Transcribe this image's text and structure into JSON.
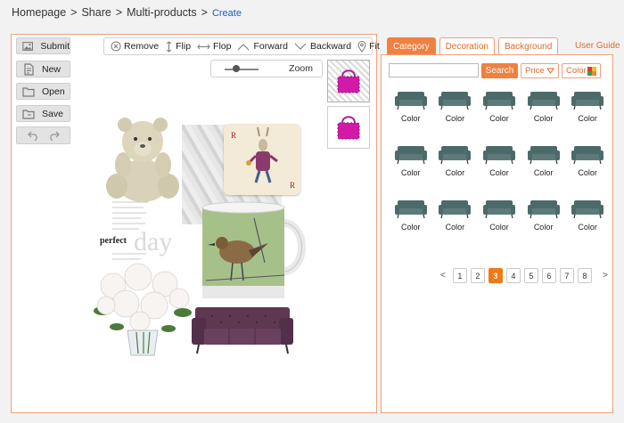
{
  "breadcrumb": {
    "items": [
      "Homepage",
      "Share",
      "Multi-products"
    ],
    "separator": ">",
    "current": "Create"
  },
  "editor": {
    "side_buttons": [
      {
        "label": "Submit",
        "icon": "image-icon"
      },
      {
        "label": "New",
        "icon": "new-file-icon"
      },
      {
        "label": "Open",
        "icon": "folder-icon"
      },
      {
        "label": "Save",
        "icon": "save-folder-icon"
      }
    ],
    "undo_icon": "undo-icon",
    "redo_icon": "redo-icon",
    "toolbar": [
      {
        "label": "Remove",
        "icon": "remove-icon"
      },
      {
        "label": "Flip",
        "icon": "flip-vertical-icon"
      },
      {
        "label": "Flop",
        "icon": "flop-horizontal-icon"
      },
      {
        "label": "Forward",
        "icon": "forward-icon"
      },
      {
        "label": "Backward",
        "icon": "backward-icon"
      },
      {
        "label": "Fit",
        "icon": "fit-icon"
      }
    ],
    "zoom_label": "Zoom",
    "zoom_level": 0.2,
    "canvas_text": {
      "perfect": "perfect",
      "day": "day"
    }
  },
  "right_panel": {
    "tabs": [
      "Category",
      "Decoration",
      "Background"
    ],
    "active_tab": 0,
    "user_guide": "User Guide",
    "search": {
      "value": "",
      "button": "Search"
    },
    "filters": {
      "price": "Price",
      "color": "Color"
    },
    "product_label": "Color",
    "product_color": "#4d6a6a",
    "pagination": {
      "prev": "<",
      "next": ">",
      "pages": [
        "1",
        "2",
        "3",
        "4",
        "5",
        "6",
        "7",
        "8"
      ],
      "current": "3"
    }
  },
  "colors": {
    "accent": "#f08040",
    "border_accent": "#f0a07a",
    "link": "#1f5fb8"
  }
}
